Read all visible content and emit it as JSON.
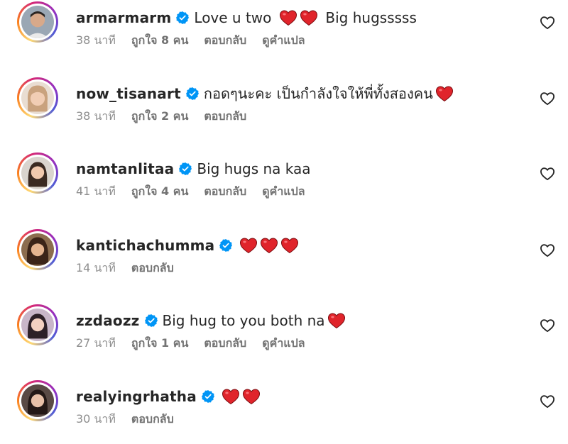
{
  "colors": {
    "verified": "#0095f6",
    "heart": "#e0242b",
    "meta_text": "#8e8e8e"
  },
  "icons": {
    "verified": "verified-badge-icon",
    "like": "heart-outline-icon",
    "emoji": "red-heart-emoji"
  },
  "comments": [
    {
      "username": "armarmarm",
      "text": "Love u two",
      "hearts": 2,
      "text_after_hearts": "Big hugsssss",
      "time": "38 นาที",
      "likes": "ถูกใจ 8 คน",
      "reply": "ตอบกลับ",
      "translate": "ดูคำแปล"
    },
    {
      "username": "now_tisanart",
      "text": "กอดๆนะคะ เป็นกำลังใจให้พี่ทั้งสองคน",
      "hearts": 1,
      "text_after_hearts": "",
      "time": "38 นาที",
      "likes": "ถูกใจ 2 คน",
      "reply": "ตอบกลับ",
      "translate": ""
    },
    {
      "username": "namtanlitaa",
      "text": "Big hugs na kaa",
      "hearts": 0,
      "text_after_hearts": "",
      "time": "41 นาที",
      "likes": "ถูกใจ 4 คน",
      "reply": "ตอบกลับ",
      "translate": "ดูคำแปล"
    },
    {
      "username": "kantichachumma",
      "text": "",
      "hearts": 3,
      "text_after_hearts": "",
      "time": "14 นาที",
      "likes": "",
      "reply": "ตอบกลับ",
      "translate": ""
    },
    {
      "username": "zzdaozz",
      "text": "Big hug to you both na",
      "hearts": 1,
      "text_after_hearts": "",
      "time": "27 นาที",
      "likes": "ถูกใจ 1 คน",
      "reply": "ตอบกลับ",
      "translate": "ดูคำแปล"
    },
    {
      "username": "realyingrhatha",
      "text": "",
      "hearts": 2,
      "text_after_hearts": "",
      "time": "30 นาที",
      "likes": "",
      "reply": "ตอบกลับ",
      "translate": ""
    }
  ]
}
